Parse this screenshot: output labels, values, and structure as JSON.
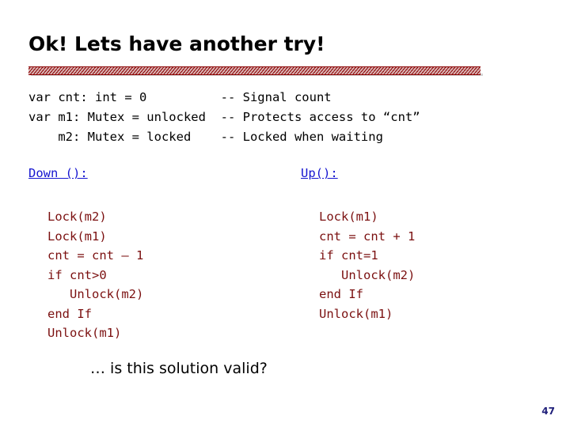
{
  "slide": {
    "title": "Ok! Lets have another try!",
    "declarations": "var cnt: int = 0          -- Signal count\nvar m1: Mutex = unlocked  -- Protects access to “cnt”\n    m2: Mutex = locked    -- Locked when waiting",
    "down_header": "Down ():",
    "up_header": "Up():",
    "down_code": "Lock(m2)\nLock(m1)\ncnt = cnt – 1\nif cnt>0\n   Unlock(m2)\nend If\nUnlock(m1)",
    "up_code": "Lock(m1)\ncnt = cnt + 1\nif cnt=1\n   Unlock(m2)\nend If\nUnlock(m1)",
    "question": "… is this solution valid?",
    "page_number": "47",
    "colors": {
      "code": "#7b1010",
      "header_link": "#1515d0",
      "rule": "#8b0000",
      "page_number": "#20207a"
    }
  }
}
